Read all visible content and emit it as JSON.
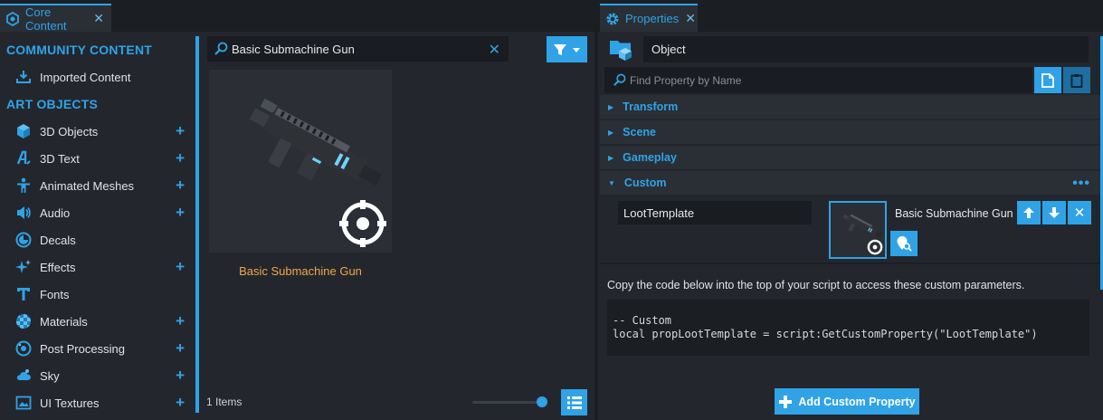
{
  "core_content": {
    "tab_label": "Core Content",
    "sidebar": {
      "community_header": "COMMUNITY CONTENT",
      "imported_label": "Imported Content",
      "art_header": "ART OBJECTS",
      "items": [
        {
          "label": "3D Objects",
          "icon": "cube-icon",
          "plus": true
        },
        {
          "label": "3D Text",
          "icon": "3d-text-icon",
          "plus": true
        },
        {
          "label": "Animated Meshes",
          "icon": "person-icon",
          "plus": true
        },
        {
          "label": "Audio",
          "icon": "speaker-icon",
          "plus": true
        },
        {
          "label": "Decals",
          "icon": "decal-icon",
          "plus": false
        },
        {
          "label": "Effects",
          "icon": "sparkle-icon",
          "plus": true
        },
        {
          "label": "Fonts",
          "icon": "font-icon",
          "plus": false
        },
        {
          "label": "Materials",
          "icon": "checker-ball-icon",
          "plus": true
        },
        {
          "label": "Post Processing",
          "icon": "post-processing-icon",
          "plus": true
        },
        {
          "label": "Sky",
          "icon": "sky-icon",
          "plus": true
        },
        {
          "label": "UI Textures",
          "icon": "image-icon",
          "plus": true
        }
      ]
    },
    "search_value": "Basic Submachine Gun",
    "tile_label": "Basic Submachine Gun",
    "items_count": "1 Items"
  },
  "properties": {
    "tab_label": "Properties",
    "object_name": "Object",
    "find_placeholder": "Find Property by Name",
    "sections": {
      "transform": "Transform",
      "scene": "Scene",
      "gameplay": "Gameplay",
      "custom": "Custom"
    },
    "custom_property": {
      "name": "LootTemplate",
      "asset_name": "Basic Submachine Gun"
    },
    "copy_hint": "Copy the code below into the top of your script to access these custom parameters.",
    "code_line_1": "-- Custom",
    "code_line_2": "local propLootTemplate = script:GetCustomProperty(\"LootTemplate\")",
    "add_button_label": "Add Custom Property"
  },
  "colors": {
    "accent": "#2fa3e6",
    "tile_label": "#f0a64a",
    "panel_bg": "#23272d",
    "input_bg": "#191c20"
  }
}
